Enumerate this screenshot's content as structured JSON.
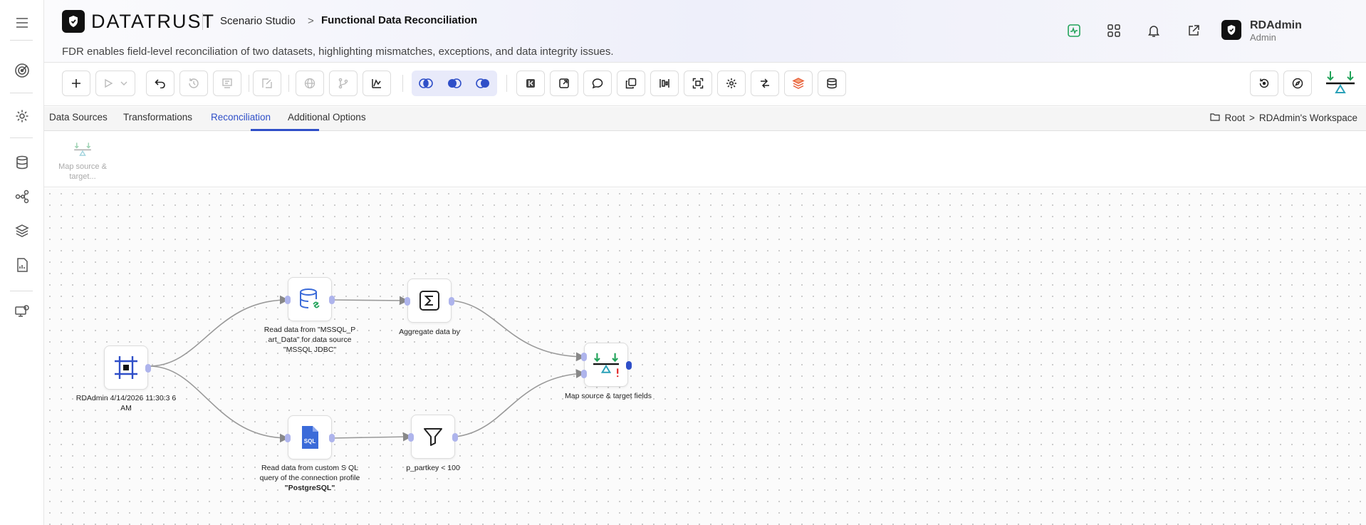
{
  "app": {
    "brand": "DATATRUST",
    "breadcrumb_studio": "Scenario Studio",
    "breadcrumb_sep": ">",
    "page_title": "Functional Data Reconciliation",
    "description": "FDR enables field-level reconciliation of two datasets, highlighting mismatches, exceptions, and data integrity issues."
  },
  "user": {
    "name": "RDAdmin",
    "role": "Admin"
  },
  "tabs": [
    {
      "label": "Data Sources"
    },
    {
      "label": "Transformations"
    },
    {
      "label": "Reconciliation",
      "active": true
    },
    {
      "label": "Additional Options"
    }
  ],
  "workspace": {
    "root": "Root",
    "sep": ">",
    "name": "RDAdmin's Workspace"
  },
  "palette": {
    "item_label": "Map source & target..."
  },
  "nodes": {
    "start": {
      "label": "RDAdmin 4/14/2026 11:30:3 6 AM"
    },
    "read_mssql": {
      "label": "Read data from \"MSSQL_P art_Data\" for data source \"MSSQL JDBC\""
    },
    "read_sql": {
      "label_prefix": "Read data from custom S QL query of the connection profile ",
      "label_bold": "\"PostgreSQL\""
    },
    "aggregate": {
      "label": "Aggregate data by"
    },
    "filter": {
      "label": "p_partkey < 100"
    },
    "map": {
      "label": "Map source & target fields"
    }
  },
  "colors": {
    "accent": "#2f4fc8",
    "port": "#aeb4ec",
    "green": "#22a35a",
    "teal": "#2aa1b8",
    "error": "#e02424"
  }
}
